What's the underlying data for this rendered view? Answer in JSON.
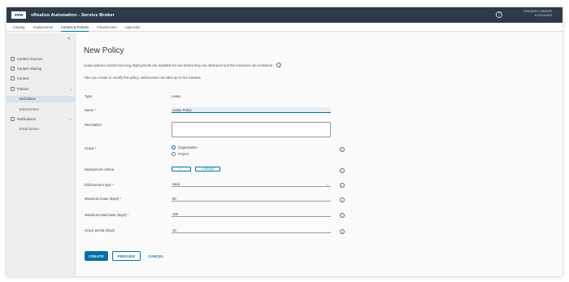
{
  "header": {
    "logo": "vmw",
    "title": "vRealize Automation - Service Broker",
    "help_glyph": "?",
    "user_line1": "VRADEMO.VMWARE",
    "user_line2": "JLYVISHMEN"
  },
  "nav": {
    "tabs": [
      "Catalog",
      "Deployments",
      "Content & Policies",
      "Infrastructure",
      "Approvals"
    ],
    "active": "Content & Policies"
  },
  "sidebar": {
    "collapse_glyph": "«",
    "items": {
      "content_sources": "Content Sources",
      "content_sharing": "Content Sharing",
      "content": "Content",
      "policies": "Policies",
      "definitions": "Definitions",
      "enforcement": "Enforcement",
      "notifications": "Notifications",
      "email_server": "Email Server"
    }
  },
  "page": {
    "title": "New Policy",
    "description": "Lease policies control how long deployments are available for use before they are destroyed and the resources are reclaimed.",
    "note": "After you create or modify this policy, enforcement can take up to five minutes."
  },
  "form": {
    "type_label": "Type",
    "type_value": "Lease",
    "name_label": "Name *",
    "name_value": "Lease Policy",
    "description_label": "Description",
    "description_value": "",
    "scope_label": "Scope *",
    "scope_options": [
      "Organization",
      "Project"
    ],
    "scope_selected": "Organization",
    "criteria_label": "Deployment criteria",
    "criteria_button1": "+ ...",
    "criteria_button2": "+ GROUP",
    "enforcement_label": "Enforcement type *",
    "enforcement_value": "Hard",
    "max_lease_label": "Maximum lease (days) *",
    "max_lease_value": "60",
    "max_total_label": "Maximum total lease (days) *",
    "max_total_value": "100",
    "grace_label": "Grace period (days)",
    "grace_value": "10"
  },
  "actions": {
    "create": "CREATE",
    "preview": "PREVIEW",
    "cancel": "CANCEL"
  },
  "colors": {
    "header": "#2d3a4a",
    "accent": "#0072a3"
  }
}
